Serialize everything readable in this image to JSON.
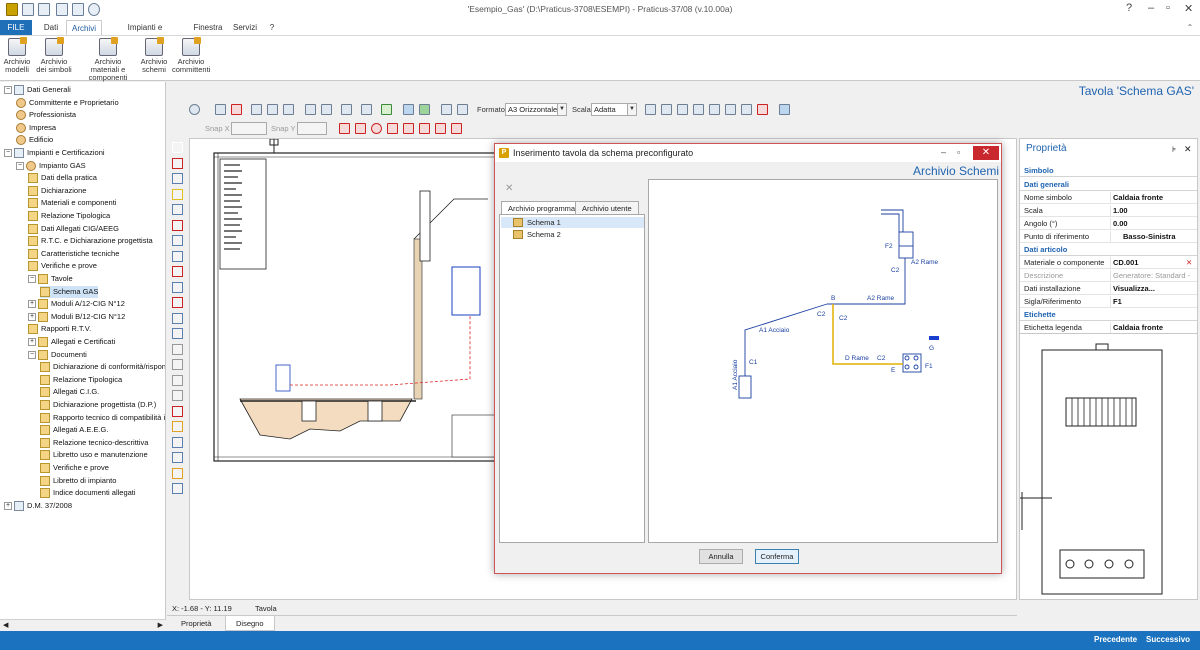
{
  "window": {
    "title": "'Esempio_Gas' (D:\\Praticus-3708\\ESEMPI) - Praticus-37/08 (v.10.00a)"
  },
  "menu": {
    "file": "FILE",
    "items": [
      "Dati",
      "Archivi",
      "Impianti e Certificazioni",
      "Finestra",
      "Servizi",
      "?"
    ]
  },
  "ribbon": {
    "buttons": [
      {
        "label": "Archivio modelli"
      },
      {
        "label": "Archivio dei simboli"
      },
      {
        "label": "Archivio materiali e componenti"
      },
      {
        "label": "Archivio schemi"
      },
      {
        "label": "Archivio committenti"
      }
    ]
  },
  "tree": {
    "items": [
      {
        "label": "Dati Generali",
        "level": 0,
        "exp": "−"
      },
      {
        "label": "Committente e Proprietario",
        "level": 1
      },
      {
        "label": "Professionista",
        "level": 1
      },
      {
        "label": "Impresa",
        "level": 1
      },
      {
        "label": "Edificio",
        "level": 1
      },
      {
        "label": "Impianti e Certificazioni",
        "level": 0,
        "exp": "−"
      },
      {
        "label": "Impianto GAS",
        "level": 1,
        "exp": "−"
      },
      {
        "label": "Dati della pratica",
        "level": 2
      },
      {
        "label": "Dichiarazione",
        "level": 2
      },
      {
        "label": "Materiali e componenti",
        "level": 2
      },
      {
        "label": "Relazione Tipologica",
        "level": 2
      },
      {
        "label": "Dati Allegati CIG/AEEG",
        "level": 2
      },
      {
        "label": "R.T.C. e Dichiarazione progettista",
        "level": 2
      },
      {
        "label": "Caratteristiche tecniche",
        "level": 2
      },
      {
        "label": "Verifiche e prove",
        "level": 2
      },
      {
        "label": "Tavole",
        "level": 2,
        "exp": "−"
      },
      {
        "label": "Schema GAS",
        "level": 3,
        "selected": true
      },
      {
        "label": "Moduli A/12-CIG N°12",
        "level": 2,
        "exp": "+"
      },
      {
        "label": "Moduli B/12-CIG N°12",
        "level": 2,
        "exp": "+"
      },
      {
        "label": "Rapporti R.T.V.",
        "level": 2
      },
      {
        "label": "Allegati e Certificati",
        "level": 2,
        "exp": "+"
      },
      {
        "label": "Documenti",
        "level": 2,
        "exp": "−"
      },
      {
        "label": "Dichiarazione di conformità/rispon",
        "level": 3
      },
      {
        "label": "Relazione Tipologica",
        "level": 3
      },
      {
        "label": "Allegati C.I.G.",
        "level": 3
      },
      {
        "label": "Dichiarazione progettista (D.P.)",
        "level": 3
      },
      {
        "label": "Rapporto tecnico di compatibilità i",
        "level": 3
      },
      {
        "label": "Allegati A.E.E.G.",
        "level": 3
      },
      {
        "label": "Relazione tecnico-descrittiva",
        "level": 3
      },
      {
        "label": "Libretto uso e manutenzione",
        "level": 3
      },
      {
        "label": "Verifiche e prove",
        "level": 3
      },
      {
        "label": "Libretto di impianto",
        "level": 3
      },
      {
        "label": "Indice documenti allegati",
        "level": 3
      },
      {
        "label": "D.M. 37/2008",
        "level": 0,
        "exp": "+"
      }
    ]
  },
  "toolbar": {
    "formato_label": "Formato",
    "formato_value": "A3 Orizzontale",
    "scala_label": "Scala",
    "scala_value": "Adatta",
    "snapx": "Snap X",
    "snapy": "Snap Y"
  },
  "page_title": "Tavola 'Schema GAS'",
  "status": {
    "coords": "X: -1.68 - Y: 11.19",
    "sheet": "Tavola"
  },
  "bottom_tabs": [
    "Proprietà",
    "Disegno"
  ],
  "dialog": {
    "title": "Inserimento tavola da schema preconfigurato",
    "heading": "Archivio Schemi",
    "tabs": [
      "Archivio programma",
      "Archivio utente"
    ],
    "schemas": [
      "Schema 1",
      "Schema 2"
    ],
    "cancel": "Annulla",
    "confirm": "Conferma",
    "preview_labels": [
      "F2",
      "A2 Rame",
      "C2",
      "B",
      "C2",
      "C2",
      "A2 Rame",
      "A1 Acciaio",
      "D Rame",
      "C2",
      "G",
      "F1",
      "E",
      "C1",
      "A1 Acciaio"
    ]
  },
  "properties": {
    "title": "Proprietà",
    "sections": [
      {
        "name": "Simbolo"
      },
      {
        "name": "Dati generali",
        "rows": [
          {
            "k": "Nome simbolo",
            "v": "Caldaia fronte"
          },
          {
            "k": "Scala",
            "v": "1.00"
          },
          {
            "k": "Angolo (°)",
            "v": "0.00"
          },
          {
            "k": "Punto di riferimento",
            "v": "Basso-Sinistra"
          }
        ]
      },
      {
        "name": "Dati articolo",
        "rows": [
          {
            "k": "Materiale o componente",
            "v": "CD.001"
          },
          {
            "k": "Descrizione",
            "v": "Generatore: Standard - ..."
          },
          {
            "k": "Dati installazione",
            "v": "Visualizza..."
          },
          {
            "k": "Sigla/Riferimento",
            "v": "F1"
          }
        ]
      },
      {
        "name": "Etichette",
        "rows": [
          {
            "k": "Etichetta legenda",
            "v": "Caldaia fronte"
          }
        ]
      }
    ]
  },
  "footer": {
    "prev": "Precedente",
    "next": "Successivo"
  },
  "colors": {
    "accent": "#1b73bf",
    "title_blue": "#1f63b1",
    "close_red": "#c8282e"
  }
}
